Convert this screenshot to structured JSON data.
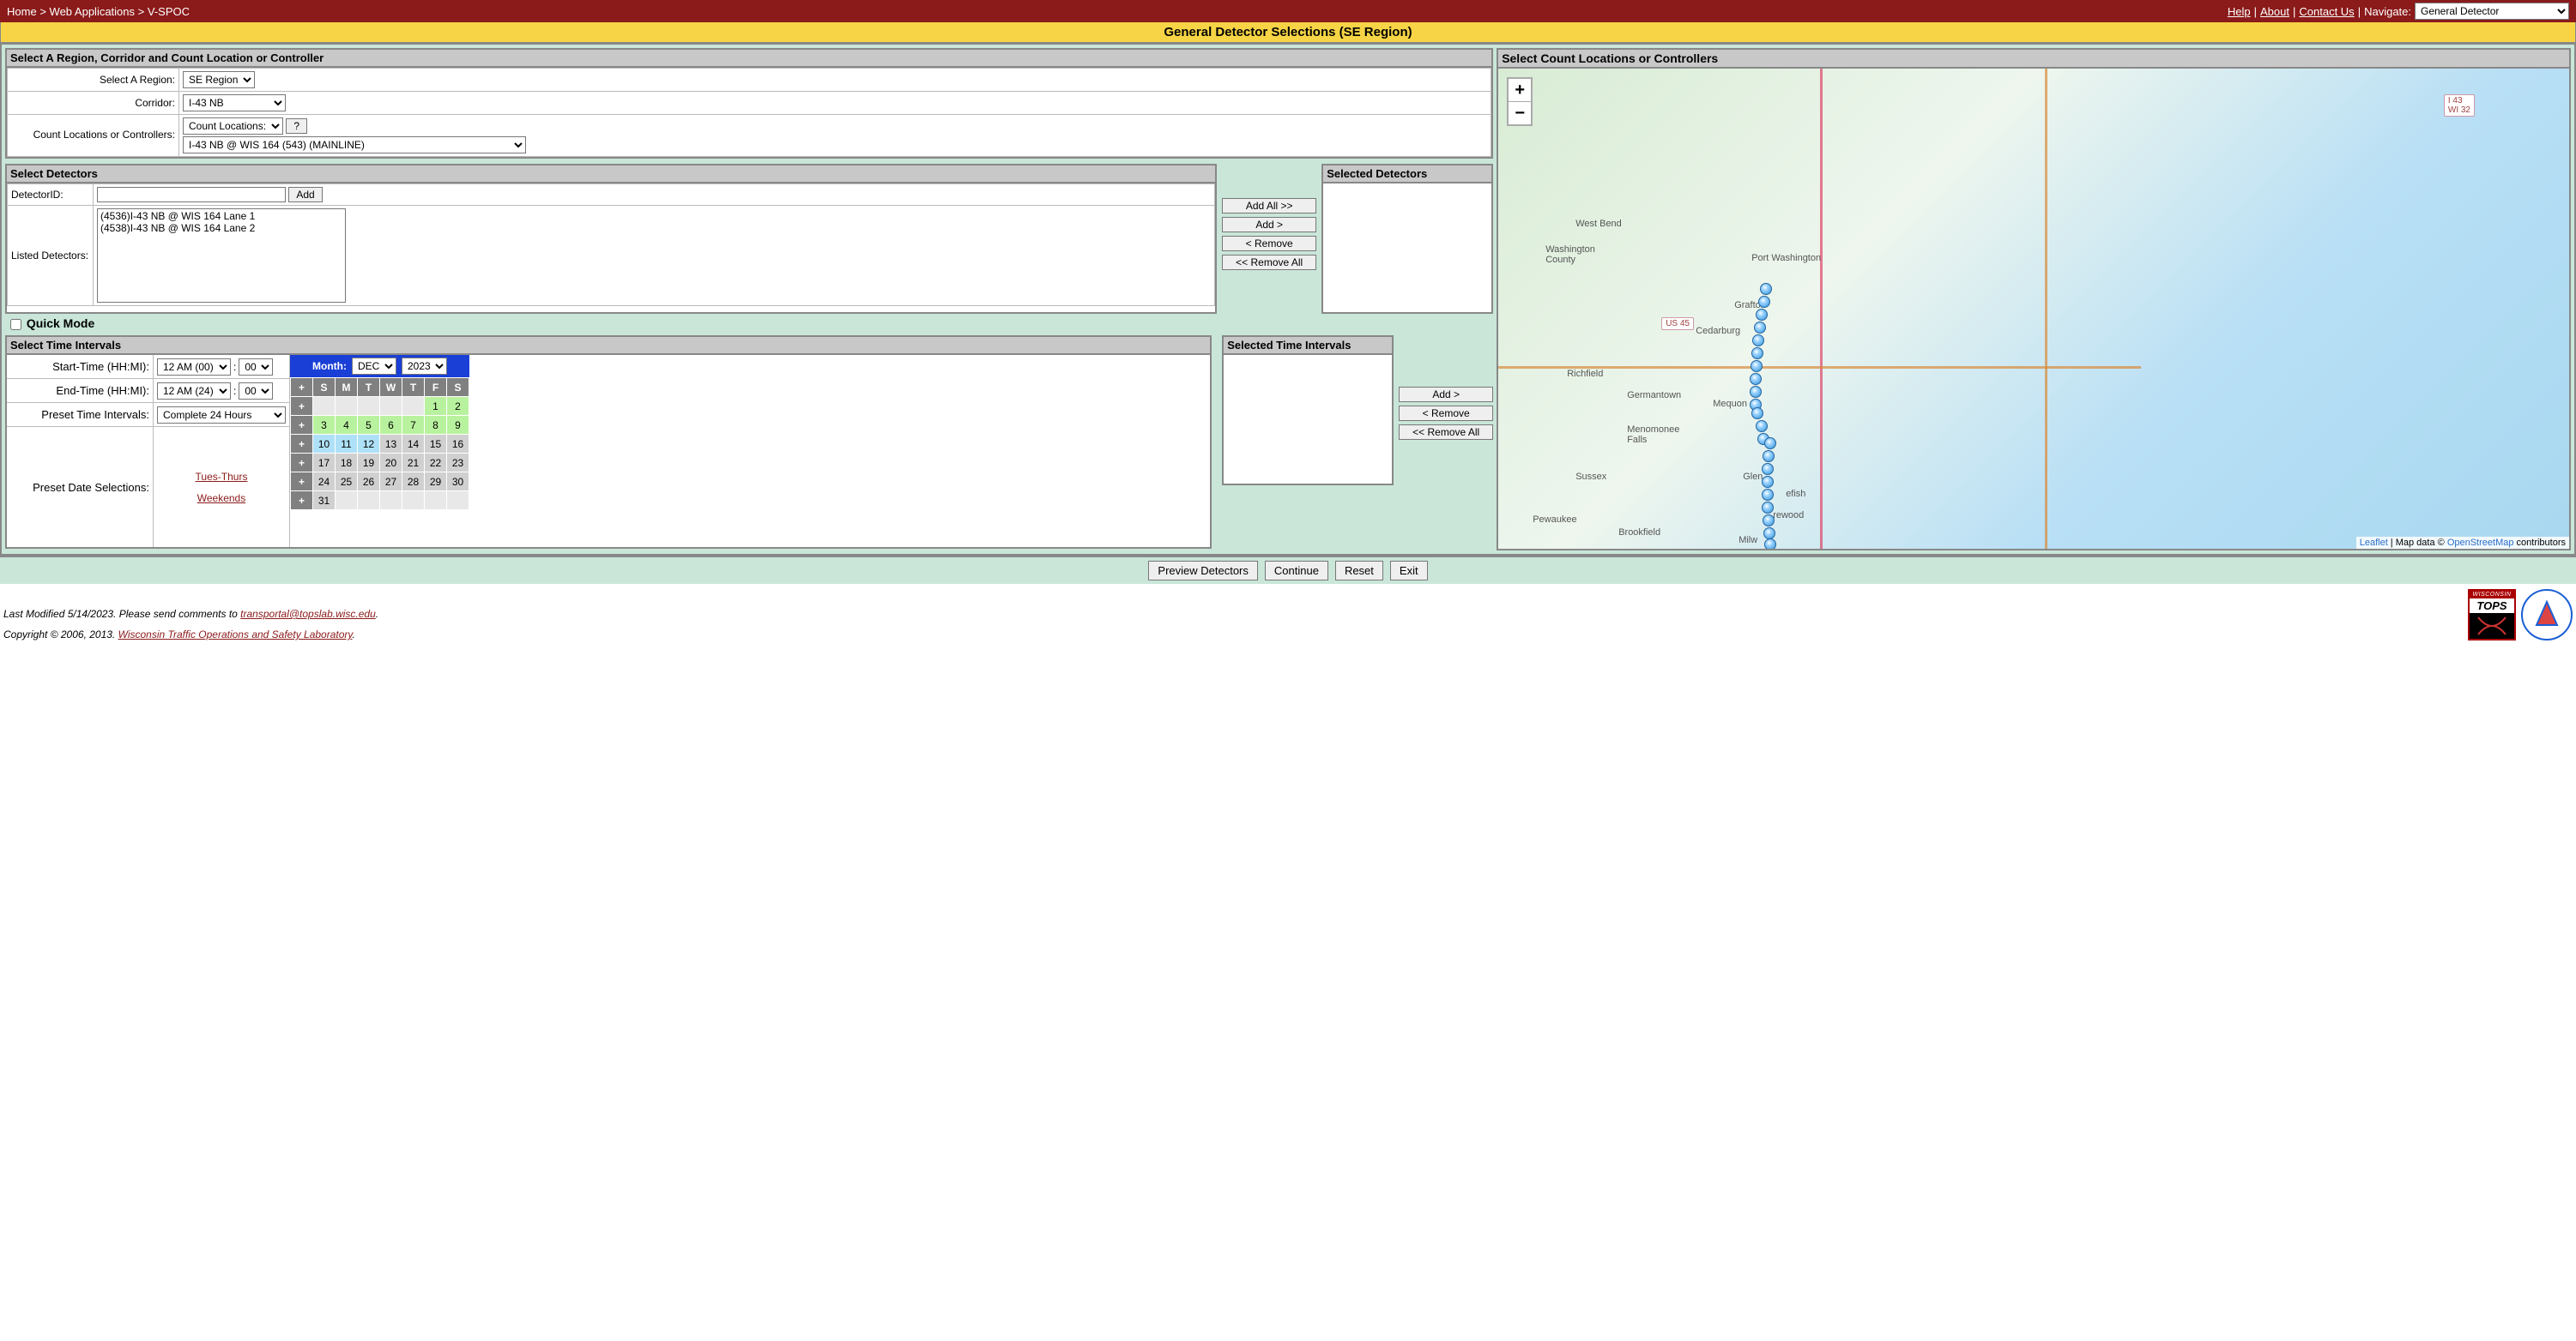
{
  "breadcrumb": {
    "home": "Home",
    "sep": " > ",
    "webapps": "Web Applications",
    "vspoc": "V-SPOC"
  },
  "topright": {
    "help": "Help",
    "about": "About",
    "contact": "Contact Us",
    "navigate": "Navigate:",
    "nav_value": "General Detector"
  },
  "title": "General Detector Selections (SE Region)",
  "region_panel": {
    "header": "Select A Region, Corridor and Count Location or Controller",
    "region_label": "Select A Region:",
    "region_value": "SE Region",
    "corridor_label": "Corridor:",
    "corridor_value": "I-43 NB",
    "loc_label": "Count Locations or Controllers:",
    "loc_type": "Count Locations:",
    "help_btn": "?",
    "loc_value": "I-43 NB @ WIS 164 (543) (MAINLINE)"
  },
  "detectors": {
    "header": "Select Detectors",
    "id_label": "DetectorID:",
    "add_btn": "Add",
    "listed_label": "Listed Detectors:",
    "items": [
      "(4536)I-43 NB @ WIS 164 Lane 1",
      "(4538)I-43 NB @ WIS 164 Lane 2"
    ],
    "selected_header": "Selected Detectors",
    "addall": "Add All >>",
    "add1": "Add >",
    "rem1": "< Remove",
    "remall": "<< Remove All"
  },
  "quick": "Quick Mode",
  "time": {
    "header": "Select Time Intervals",
    "start_label": "Start-Time (HH:MI):",
    "start_hour": "12 AM (00)",
    "start_min": "00",
    "end_label": "End-Time (HH:MI):",
    "end_hour": "12 AM (24)",
    "end_min": "00",
    "preset_label": "Preset Time Intervals:",
    "preset_value": "Complete 24 Hours",
    "presetdate_label": "Preset Date Selections:",
    "tuethu": "Tues-Thurs",
    "weekends": "Weekends",
    "month_label": "Month:",
    "month": "DEC",
    "year": "2023",
    "dow": [
      "+",
      "S",
      "M",
      "T",
      "W",
      "T",
      "F",
      "S"
    ]
  },
  "sel_time": {
    "header": "Selected Time Intervals",
    "add": "Add >",
    "rem": "< Remove",
    "remall": "<< Remove All"
  },
  "map": {
    "header": "Select Count Locations or Controllers",
    "zoom_in": "+",
    "zoom_out": "−",
    "credit_leaflet": "Leaflet",
    "credit_mid": " | Map data © ",
    "credit_osm": "OpenStreetMap",
    "credit_tail": " contributors",
    "road1": "I 43\nWI 32",
    "road2": "US 45",
    "cities": {
      "westbend": "West Bend",
      "washington": "Washington\nCounty",
      "portw": "Port Washington",
      "grafton": "Grafton",
      "cedarburg": "Cedarburg",
      "richfield": "Richfield",
      "germantown": "Germantown",
      "mequon": "Mequon",
      "menomonee": "Menomonee\nFalls",
      "sussex": "Sussex",
      "pewaukee": "Pewaukee",
      "brookfield": "Brookfield",
      "glen": "Glen",
      "fish": "efish",
      "rewood": "rewood",
      "milw": "Milw"
    }
  },
  "buttons": {
    "preview": "Preview Detectors",
    "continue": "Continue",
    "reset": "Reset",
    "exit": "Exit"
  },
  "footer": {
    "modified": "Last Modified 5/14/2023. Please send comments to ",
    "email": "transportal@topslab.wisc.edu",
    "copyright": "Copyright © 2006, 2013. ",
    "lab": "Wisconsin Traffic Operations and Safety Laboratory",
    "tops_wisconsin": "WISCONSIN",
    "tops": "TOPS"
  }
}
